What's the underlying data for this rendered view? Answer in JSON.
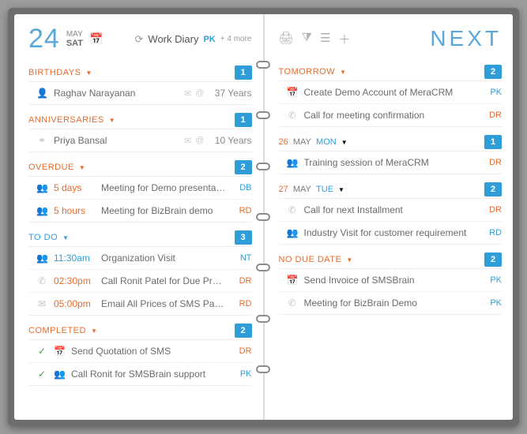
{
  "header": {
    "day_number": "24",
    "month": "MAY",
    "weekday": "SAT",
    "diary_title": "Work Diary",
    "owner_tag": "PK",
    "more": "+ 4 more"
  },
  "next_title": "NEXT",
  "left_sections": [
    {
      "title": "BIRTHDAYS",
      "style": "orange",
      "count": "1",
      "rows": [
        {
          "icon": "person",
          "desc": "Raghav Narayanan",
          "aux": "mail-at",
          "right_text": "37 Years",
          "right_kind": "years"
        }
      ]
    },
    {
      "title": "ANNIVERSARIES",
      "style": "orange",
      "count": "1",
      "rows": [
        {
          "icon": "rings",
          "desc": "Priya Bansal",
          "aux": "mail-at",
          "right_text": "10 Years",
          "right_kind": "years"
        }
      ]
    },
    {
      "title": "OVERDUE",
      "style": "orange",
      "count": "2",
      "rows": [
        {
          "icon": "people",
          "time": "5 days",
          "time_style": "red",
          "desc": "Meeting for Demo presentation",
          "init": "DB",
          "init_style": "blue"
        },
        {
          "icon": "people",
          "time": "5 hours",
          "time_style": "red",
          "desc": "Meeting for BizBrain demo",
          "init": "RD",
          "init_style": "red"
        }
      ]
    },
    {
      "title": "TO DO",
      "style": "blue",
      "count": "3",
      "rows": [
        {
          "icon": "people",
          "time": "11:30am",
          "time_style": "blue",
          "desc": "Organization Visit",
          "init": "NT",
          "init_style": "blue"
        },
        {
          "icon": "phone",
          "time": "02:30pm",
          "time_style": "red",
          "desc": "Call Ronit Patel for Due Premium",
          "init": "DR",
          "init_style": "red"
        },
        {
          "icon": "mail",
          "time": "05:00pm",
          "time_style": "red",
          "desc": "Email All Prices of SMS Packs",
          "init": "RD",
          "init_style": "red"
        }
      ]
    },
    {
      "title": "COMPLETED",
      "style": "orange",
      "count": "2",
      "rows": [
        {
          "icon": "check",
          "icon2": "calendar",
          "desc": "Send Quotation of SMS",
          "init": "DR",
          "init_style": "red"
        },
        {
          "icon": "check",
          "icon2": "people",
          "desc": "Call Ronit for SMSBrain support",
          "init": "PK",
          "init_style": "blue"
        }
      ]
    }
  ],
  "right_sections": [
    {
      "title": "TOMORROW",
      "style": "orange",
      "count": "2",
      "rows": [
        {
          "icon": "calendar",
          "desc": "Create Demo Account of MeraCRM",
          "init": "PK",
          "init_style": "blue"
        },
        {
          "icon": "phone",
          "desc": "Call for meeting confirmation",
          "init": "DR",
          "init_style": "red"
        }
      ]
    },
    {
      "date_html": "26  MAY   MON",
      "count": "1",
      "rows": [
        {
          "icon": "people",
          "desc": "Training session of MeraCRM",
          "init": "DR",
          "init_style": "red"
        }
      ]
    },
    {
      "date_html": "27  MAY   TUE",
      "count": "2",
      "rows": [
        {
          "icon": "phone",
          "desc": "Call for next Installment",
          "init": "DR",
          "init_style": "red"
        },
        {
          "icon": "people",
          "desc": "Industry Visit for customer requirement",
          "init": "RD",
          "init_style": "blue"
        }
      ]
    },
    {
      "title": "NO DUE DATE",
      "style": "orange",
      "count": "2",
      "rows": [
        {
          "icon": "calendar",
          "desc": "Send Invoice of SMSBrain",
          "init": "PK",
          "init_style": "blue"
        },
        {
          "icon": "phone",
          "desc": "Meeting for BizBrain Demo",
          "init": "PK",
          "init_style": "blue"
        }
      ]
    }
  ]
}
